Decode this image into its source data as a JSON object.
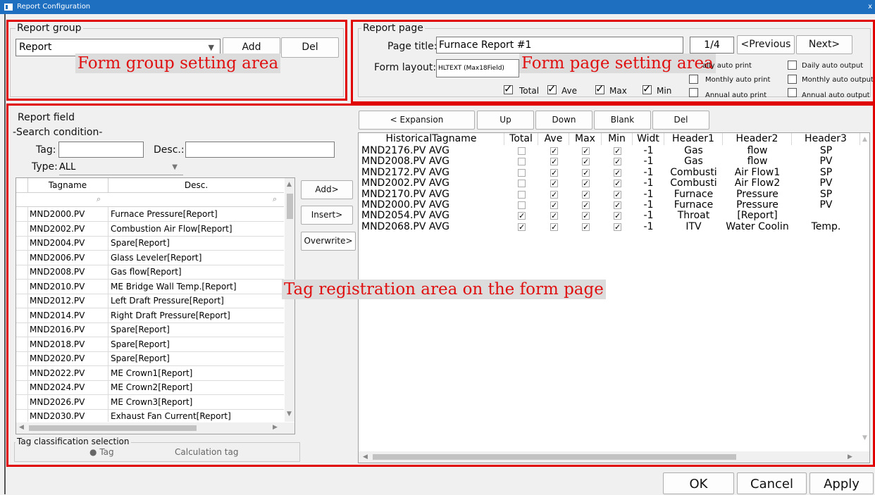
{
  "window": {
    "title": "Report Configuration",
    "close": "x"
  },
  "report_group": {
    "legend": "Report group",
    "select_value": "Report",
    "add_label": "Add",
    "del_label": "Del",
    "annotation": "Form group setting area"
  },
  "report_page": {
    "legend": "Report page",
    "page_title_label": "Page title:",
    "page_title_value": "Furnace Report #1",
    "page_counter": "1/4",
    "prev_label": "<Previous",
    "next_label": "Next>",
    "form_layout_label": "Form layout:",
    "form_layout_value": "HLTEXT (Max18Field)",
    "annotation": "Form page setting area",
    "checks": [
      {
        "label": "Total",
        "checked": true
      },
      {
        "label": "Ave",
        "checked": true
      },
      {
        "label": "Max",
        "checked": true
      },
      {
        "label": "Min",
        "checked": true
      }
    ],
    "auto_options": [
      {
        "label": "aily auto print",
        "checked": false
      },
      {
        "label": "Monthly auto print",
        "checked": false
      },
      {
        "label": "Annual auto print",
        "checked": false
      },
      {
        "label": "Daily auto output",
        "checked": false
      },
      {
        "label": "Monthly auto output",
        "checked": false
      },
      {
        "label": "Annual auto output",
        "checked": false
      }
    ]
  },
  "report_field": {
    "title": "Report field",
    "search_title": "-Search condition-",
    "tag_label": "Tag:",
    "tag_value": "",
    "desc_label": "Desc.:",
    "desc_value": "",
    "type_label": "Type:",
    "type_value": "ALL",
    "columns": [
      "Tagname",
      "Desc."
    ],
    "rows": [
      {
        "tag": "MND2000.PV",
        "desc": "Furnace Pressure[Report]"
      },
      {
        "tag": "MND2002.PV",
        "desc": "Combustion Air Flow[Report]"
      },
      {
        "tag": "MND2004.PV",
        "desc": "Spare[Report]"
      },
      {
        "tag": "MND2006.PV",
        "desc": "Glass Leveler[Report]"
      },
      {
        "tag": "MND2008.PV",
        "desc": "Gas flow[Report]"
      },
      {
        "tag": "MND2010.PV",
        "desc": "ME Bridge Wall Temp.[Report]"
      },
      {
        "tag": "MND2012.PV",
        "desc": "Left Draft Pressure[Report]"
      },
      {
        "tag": "MND2014.PV",
        "desc": "Right Draft Pressure[Report]"
      },
      {
        "tag": "MND2016.PV",
        "desc": "Spare[Report]"
      },
      {
        "tag": "MND2018.PV",
        "desc": "Spare[Report]"
      },
      {
        "tag": "MND2020.PV",
        "desc": "Spare[Report]"
      },
      {
        "tag": "MND2022.PV",
        "desc": "ME Crown1[Report]"
      },
      {
        "tag": "MND2024.PV",
        "desc": "ME Crown2[Report]"
      },
      {
        "tag": "MND2026.PV",
        "desc": "ME Crown3[Report]"
      },
      {
        "tag": "MND2030.PV",
        "desc": "Exhaust Fan Current[Report]"
      }
    ],
    "add_label": "Add>",
    "insert_label": "Insert>",
    "overwrite_label": "Overwrite>",
    "classification_legend": "Tag classification selection",
    "radio_tag": "Tag",
    "radio_calc": "Calculation tag",
    "annotation": "Tag registration area on the form page"
  },
  "toolbar": {
    "expansion_label": "< Expansion",
    "up_label": "Up",
    "down_label": "Down",
    "blank_label": "Blank",
    "del_label": "Del"
  },
  "grid": {
    "columns": [
      "HistoricalTagname",
      "Total",
      "Ave",
      "Max",
      "Min",
      "Widt",
      "Header1",
      "Header2",
      "Header3"
    ],
    "rows": [
      {
        "tag": "MND2176.PV  AVG",
        "total": false,
        "ave": true,
        "max": true,
        "min": true,
        "width": "-1",
        "h1": "Gas",
        "h2": "flow",
        "h3": "SP"
      },
      {
        "tag": "MND2008.PV  AVG",
        "total": false,
        "ave": true,
        "max": true,
        "min": true,
        "width": "-1",
        "h1": "Gas",
        "h2": "flow",
        "h3": "PV"
      },
      {
        "tag": "MND2172.PV  AVG",
        "total": false,
        "ave": true,
        "max": true,
        "min": true,
        "width": "-1",
        "h1": "Combusti",
        "h2": "Air Flow1",
        "h3": "SP"
      },
      {
        "tag": "MND2002.PV  AVG",
        "total": false,
        "ave": true,
        "max": true,
        "min": true,
        "width": "-1",
        "h1": "Combusti",
        "h2": "Air Flow2",
        "h3": "PV"
      },
      {
        "tag": "MND2170.PV  AVG",
        "total": false,
        "ave": true,
        "max": true,
        "min": true,
        "width": "-1",
        "h1": "Furnace",
        "h2": "Pressure",
        "h3": "SP"
      },
      {
        "tag": "MND2000.PV  AVG",
        "total": false,
        "ave": true,
        "max": true,
        "min": true,
        "width": "-1",
        "h1": "Furnace",
        "h2": "Pressure",
        "h3": "PV"
      },
      {
        "tag": "MND2054.PV  AVG",
        "total": true,
        "ave": true,
        "max": true,
        "min": true,
        "width": "-1",
        "h1": "Throat",
        "h2": "[Report]",
        "h3": ""
      },
      {
        "tag": "MND2068.PV  AVG",
        "total": true,
        "ave": true,
        "max": true,
        "min": true,
        "width": "-1",
        "h1": "ITV",
        "h2": "Water Coolin",
        "h3": "Temp."
      }
    ]
  },
  "footer": {
    "ok_label": "OK",
    "cancel_label": "Cancel",
    "apply_label": "Apply"
  },
  "colors": {
    "annotation_red": "#e00000",
    "titlebar": "#1e6fc0"
  }
}
